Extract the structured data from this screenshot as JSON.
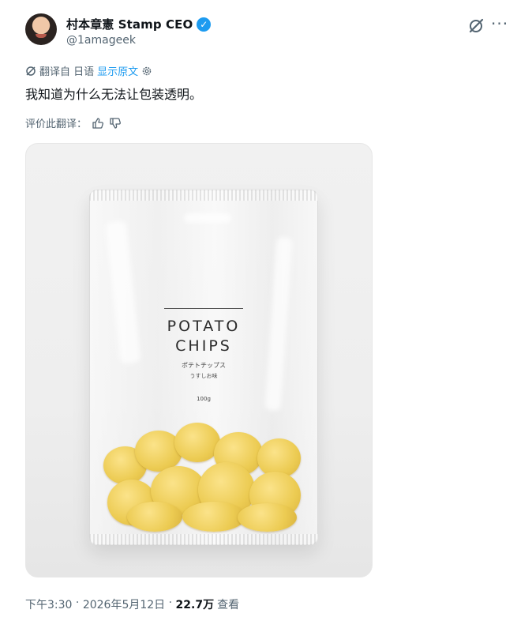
{
  "author": {
    "display_name": "村本章憲 Stamp CEO",
    "handle": "@1amageek",
    "verified": true
  },
  "header_icons": [
    "grok-icon",
    "more-icon"
  ],
  "translation": {
    "translated_from": "翻译自 日语",
    "show_original": "显示原文"
  },
  "tweet": {
    "text": "我知道为什么无法让包装透明。"
  },
  "rate": {
    "label": "评价此翻译："
  },
  "media": {
    "product_title_line1": "POTATO",
    "product_title_line2": "CHIPS",
    "product_jp": "ポテトチップス",
    "product_flavor": "うすしお味",
    "product_weight": "100g"
  },
  "meta": {
    "time": "下午3:30",
    "separator": " · ",
    "date": "2026年5月12日",
    "views_count": "22.7万",
    "views_label": "查看"
  },
  "colors": {
    "accent": "#1d9bf0",
    "secondary_text": "#536471",
    "primary_text": "#0f1419"
  }
}
